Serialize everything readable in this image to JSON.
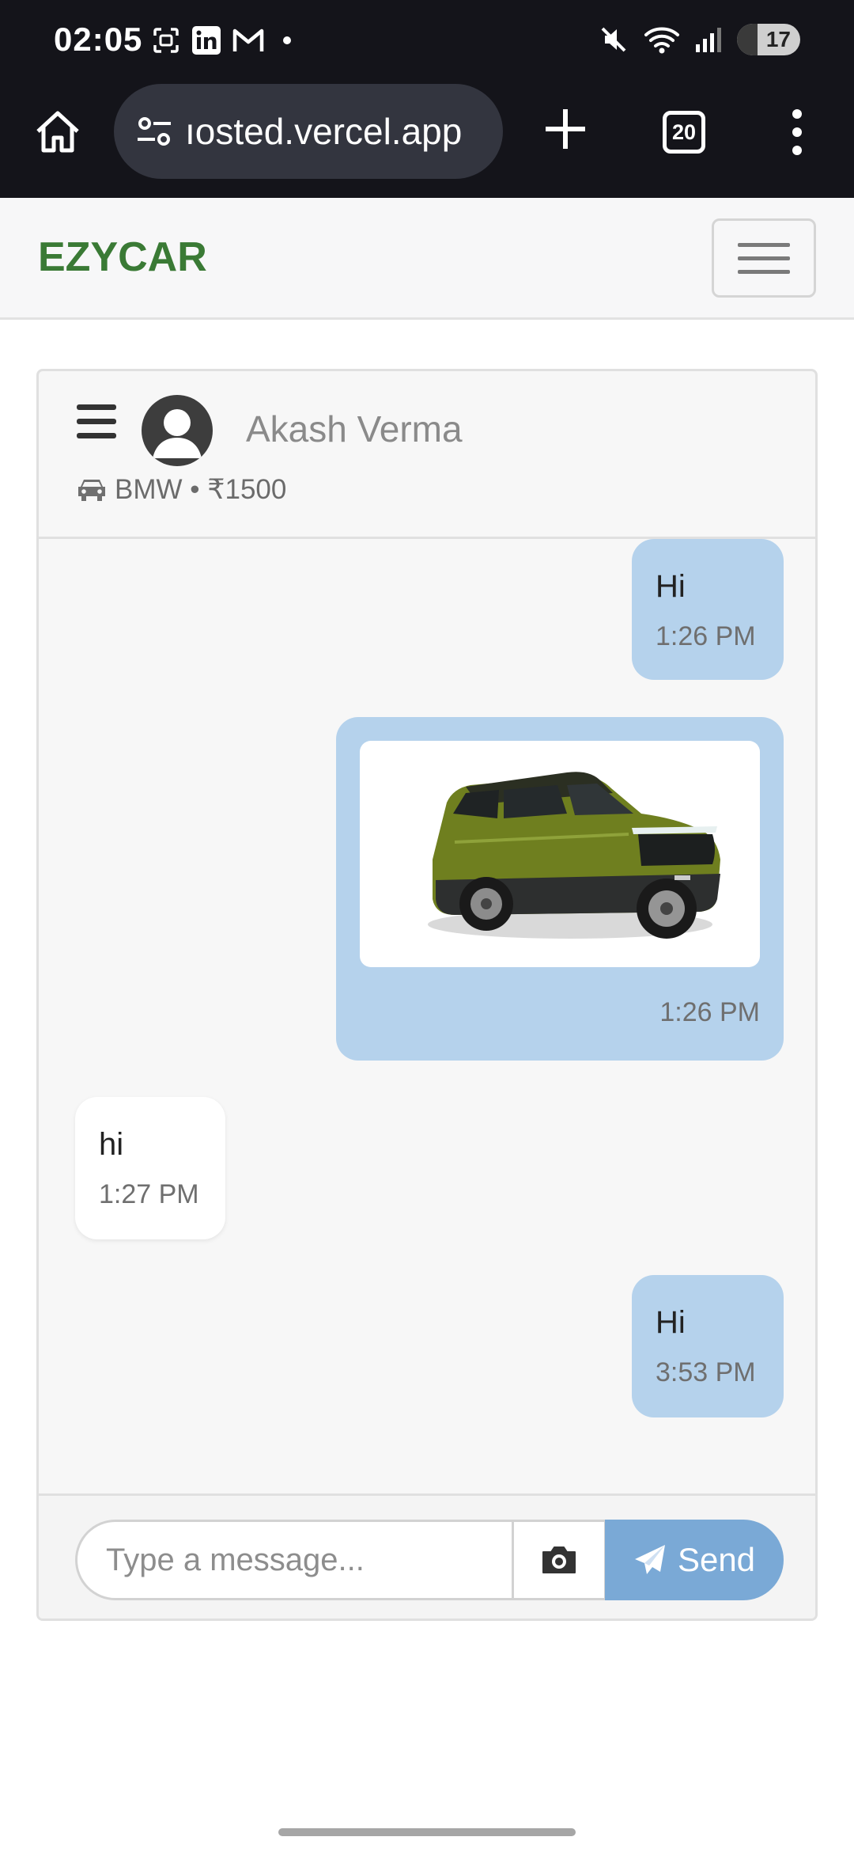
{
  "status_bar": {
    "time": "02:05",
    "battery": "17",
    "icons": [
      "screenshot-icon",
      "linkedin-icon",
      "gmail-icon",
      "notification-dot-icon",
      "mute-icon",
      "wifi-icon",
      "signal-icon",
      "battery-icon"
    ]
  },
  "browser": {
    "url": "ıosted.vercel.app",
    "tab_count": "20"
  },
  "navbar": {
    "brand": "EZYCAR",
    "brand_color": "#3a7a35"
  },
  "chat": {
    "contact_name": "Akash Verma",
    "car_info": "BMW • ₹1500",
    "messages": [
      {
        "direction": "out",
        "type": "text",
        "text": "Hi",
        "time": "1:26 PM"
      },
      {
        "direction": "out",
        "type": "image",
        "image": "green-suv-car",
        "time": "1:26 PM"
      },
      {
        "direction": "in",
        "type": "text",
        "text": "hi",
        "time": "1:27 PM"
      },
      {
        "direction": "out",
        "type": "text",
        "text": "Hi",
        "time": "3:53 PM"
      }
    ],
    "composer": {
      "placeholder": "Type a message...",
      "send_label": "Send"
    },
    "colors": {
      "outgoing_bubble": "#b5d2ec",
      "incoming_bubble": "#ffffff",
      "send_button": "#7aa9d6"
    }
  }
}
